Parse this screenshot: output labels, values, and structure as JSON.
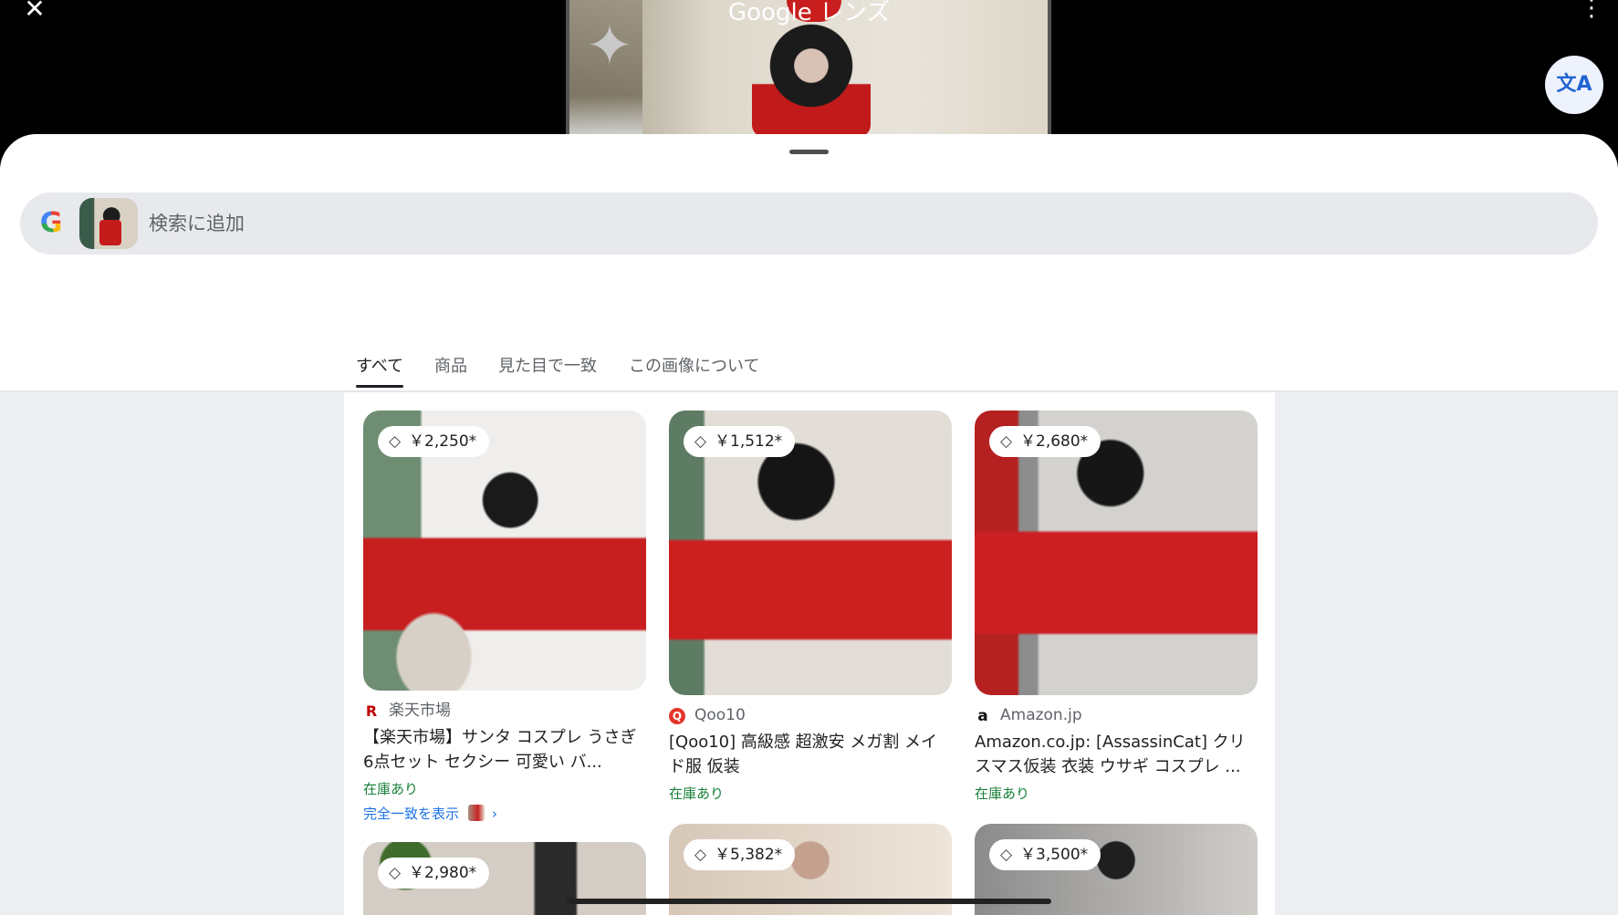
{
  "header": {
    "title": "Google レンズ",
    "close_label": "✕",
    "more_label": "⋮",
    "translate_label": "文A"
  },
  "search": {
    "placeholder": "検索に追加",
    "logo": "G"
  },
  "tabs": [
    {
      "label": "すべて",
      "active": true
    },
    {
      "label": "商品",
      "active": false
    },
    {
      "label": "見た目で一致",
      "active": false
    },
    {
      "label": "この画像について",
      "active": false
    }
  ],
  "results": [
    {
      "price": "￥2,250*",
      "source_icon": "R",
      "source": "楽天市場",
      "title": "【楽天市場】サンタ コスプレ うさぎ 6点セット セクシー 可愛い バ...",
      "stock": "在庫あり",
      "exact_match": "完全一致を表示",
      "source_color": "#bf0000"
    },
    {
      "price": "￥1,512*",
      "source_icon": "Q",
      "source": "Qoo10",
      "title": "[Qoo10] 高級感 超激安 メガ割 メイド服 仮装",
      "stock": "在庫あり",
      "source_color": "#e5342b"
    },
    {
      "price": "￥2,680*",
      "source_icon": "a",
      "source": "Amazon.jp",
      "title": "Amazon.co.jp: [AssassinCat] クリスマス仮装 衣装 ウサギ コスプレ ...",
      "stock": "在庫あり",
      "source_color": "#111111"
    },
    {
      "price": "￥2,980*"
    },
    {
      "price": "￥5,382*"
    },
    {
      "price": "￥3,500*"
    }
  ],
  "icons": {
    "close": "close-icon",
    "more": "more-vert-icon",
    "translate": "translate-icon",
    "tag": "price-tag-icon",
    "google": "google-logo-icon"
  }
}
